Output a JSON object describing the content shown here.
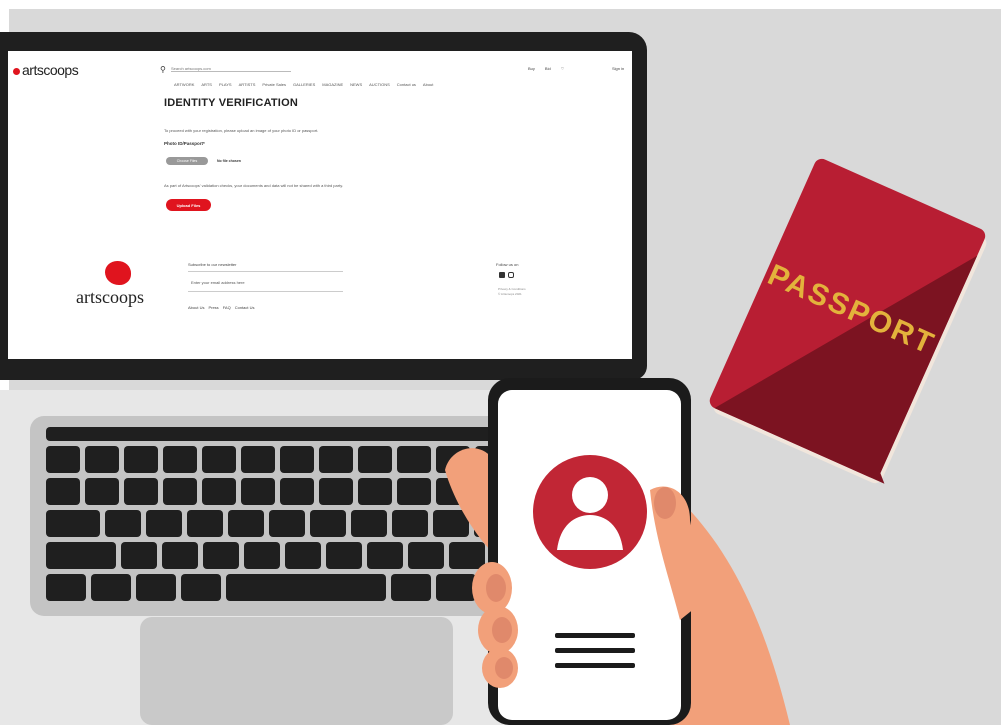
{
  "website": {
    "brand": "artscoops",
    "search_placeholder": "Search artscoops.com",
    "nav": [
      "ARTWORK",
      "ARTS",
      "PLAYS",
      "ARTISTS",
      "Private Sales",
      "GALLERIES",
      "MAGAZINE",
      "NEWS",
      "AUCTIONS",
      "Contact us",
      "About"
    ],
    "header_right": [
      "Buy",
      "Bid"
    ],
    "sign_in": "Sign in",
    "page_title": "IDENTITY VERIFICATION",
    "intro": "To proceed with your registration, please upload an image of your photo ID or passport.",
    "photo_label": "Photo ID/Passport*",
    "choose_button": "Choose Files",
    "no_file": "No file chosen",
    "note": "As part of Artscoops' validation checks, your documents and data will not be shared with a third party.",
    "upload_button": "Upload Files",
    "footer": {
      "logo": "artscoops",
      "subscribe": "Subscribe to our newsletter",
      "email_placeholder": "Enter your email address here",
      "links": [
        "About Us",
        "Press",
        "FAQ",
        "Contact Us"
      ],
      "follow": "Follow us on",
      "copy1": "Privacy & Conditions",
      "copy2": "© Artscoops 2021"
    }
  },
  "passport": {
    "label": "PASSPORT",
    "colors": {
      "light": "#b81e33",
      "dark": "#7c1321",
      "text": "#e3b23c"
    }
  },
  "phone": {
    "avatar_color": "#c12635",
    "icons": [
      "user-avatar-icon",
      "text-lines-icon"
    ]
  },
  "colors": {
    "brand_red": "#e0141e",
    "background": "#d9d9d9",
    "laptop_dark": "#1f1f1f",
    "skin": "#f2a07a"
  }
}
